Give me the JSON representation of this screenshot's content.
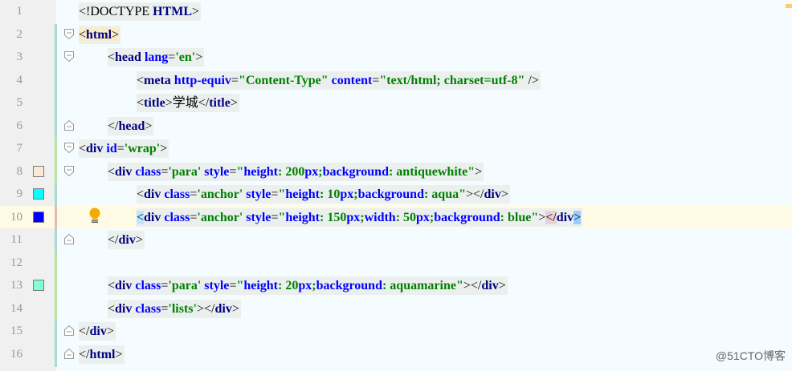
{
  "gutter": {
    "line_numbers": [
      "1",
      "2",
      "3",
      "4",
      "5",
      "6",
      "7",
      "8",
      "9",
      "10",
      "11",
      "12",
      "13",
      "14",
      "15",
      "16"
    ],
    "color_swatches": {
      "8": "#faebd7",
      "9": "#00ffff",
      "10": "#0000ff",
      "13": "#7fffd4"
    }
  },
  "editor": {
    "current_line": 10,
    "lines": [
      {
        "n": 1,
        "indent": 0,
        "fold": "",
        "tokens": [
          [
            "br",
            "<!DOCTYPE "
          ],
          [
            "tag",
            "HTML"
          ],
          [
            "br",
            ">"
          ]
        ]
      },
      {
        "n": 2,
        "indent": 0,
        "fold": "open",
        "tokens": [
          [
            "br",
            "<"
          ],
          [
            "tag",
            "html"
          ],
          [
            "br",
            ">"
          ]
        ]
      },
      {
        "n": 3,
        "indent": 1,
        "fold": "open",
        "tokens": [
          [
            "br",
            "<"
          ],
          [
            "tag",
            "head "
          ],
          [
            "attr",
            "lang"
          ],
          [
            "br",
            "="
          ],
          [
            "str",
            "'en'"
          ],
          [
            "br",
            ">"
          ]
        ]
      },
      {
        "n": 4,
        "indent": 2,
        "fold": "",
        "tokens": [
          [
            "br",
            "<"
          ],
          [
            "tag",
            "meta "
          ],
          [
            "attr",
            "http-equiv"
          ],
          [
            "br",
            "="
          ],
          [
            "str",
            "\"Content-Type\" "
          ],
          [
            "attr",
            "content"
          ],
          [
            "br",
            "="
          ],
          [
            "str",
            "\"text/html; charset=utf-8\" "
          ],
          [
            "br",
            "/>"
          ]
        ]
      },
      {
        "n": 5,
        "indent": 2,
        "fold": "",
        "tokens": [
          [
            "br",
            "<"
          ],
          [
            "tag",
            "title"
          ],
          [
            "br",
            ">"
          ],
          [
            "txt",
            "学城"
          ],
          [
            "br",
            "</"
          ],
          [
            "tag",
            "title"
          ],
          [
            "br",
            ">"
          ]
        ]
      },
      {
        "n": 6,
        "indent": 1,
        "fold": "close",
        "tokens": [
          [
            "br",
            "</"
          ],
          [
            "tag",
            "head"
          ],
          [
            "br",
            ">"
          ]
        ]
      },
      {
        "n": 7,
        "indent": 0,
        "fold": "open",
        "tokens": [
          [
            "br",
            "<"
          ],
          [
            "tag",
            "div "
          ],
          [
            "attr",
            "id"
          ],
          [
            "br",
            "="
          ],
          [
            "str",
            "'wrap'"
          ],
          [
            "br",
            ">"
          ]
        ]
      },
      {
        "n": 8,
        "indent": 1,
        "fold": "open",
        "tokens": [
          [
            "br",
            "<"
          ],
          [
            "tag",
            "div "
          ],
          [
            "attr",
            "class"
          ],
          [
            "br",
            "="
          ],
          [
            "str",
            "'para' "
          ],
          [
            "attr",
            "style"
          ],
          [
            "br",
            "="
          ],
          [
            "str",
            "\""
          ],
          [
            "attr",
            "height"
          ],
          [
            "str",
            ": 200"
          ],
          [
            "attr",
            "px"
          ],
          [
            "str",
            ";"
          ],
          [
            "attr",
            "background"
          ],
          [
            "str",
            ": antiquewhite\""
          ],
          [
            "br",
            ">"
          ]
        ]
      },
      {
        "n": 9,
        "indent": 2,
        "fold": "",
        "tokens": [
          [
            "br",
            "<"
          ],
          [
            "tag",
            "div "
          ],
          [
            "attr",
            "class"
          ],
          [
            "br",
            "="
          ],
          [
            "str",
            "'anchor' "
          ],
          [
            "attr",
            "style"
          ],
          [
            "br",
            "="
          ],
          [
            "str",
            "\""
          ],
          [
            "attr",
            "height"
          ],
          [
            "str",
            ": 10"
          ],
          [
            "attr",
            "px"
          ],
          [
            "str",
            ";"
          ],
          [
            "attr",
            "background"
          ],
          [
            "str",
            ": aqua\""
          ],
          [
            "br",
            "></"
          ],
          [
            "tag",
            "div"
          ],
          [
            "br",
            ">"
          ]
        ]
      },
      {
        "n": 10,
        "indent": 2,
        "fold": "",
        "tokens": [
          [
            "br",
            "<"
          ],
          [
            "tag",
            "div "
          ],
          [
            "attr",
            "class"
          ],
          [
            "br",
            "="
          ],
          [
            "str",
            "'anchor' "
          ],
          [
            "attr",
            "style"
          ],
          [
            "br",
            "="
          ],
          [
            "str",
            "\""
          ],
          [
            "attr",
            "height"
          ],
          [
            "str",
            ": 150"
          ],
          [
            "attr",
            "px"
          ],
          [
            "str",
            ";"
          ],
          [
            "attr",
            "width"
          ],
          [
            "str",
            ": 50"
          ],
          [
            "attr",
            "px"
          ],
          [
            "str",
            ";"
          ],
          [
            "attr",
            "background"
          ],
          [
            "str",
            ": blue\""
          ],
          [
            "br",
            ">"
          ],
          [
            "br",
            "</"
          ],
          [
            "tag",
            "div"
          ],
          [
            "br",
            ">"
          ]
        ]
      },
      {
        "n": 11,
        "indent": 1,
        "fold": "close",
        "tokens": [
          [
            "br",
            "</"
          ],
          [
            "tag",
            "div"
          ],
          [
            "br",
            ">"
          ]
        ]
      },
      {
        "n": 12,
        "indent": 0,
        "fold": "",
        "tokens": []
      },
      {
        "n": 13,
        "indent": 1,
        "fold": "",
        "tokens": [
          [
            "br",
            "<"
          ],
          [
            "tag",
            "div "
          ],
          [
            "attr",
            "class"
          ],
          [
            "br",
            "="
          ],
          [
            "str",
            "'para' "
          ],
          [
            "attr",
            "style"
          ],
          [
            "br",
            "="
          ],
          [
            "str",
            "\""
          ],
          [
            "attr",
            "height"
          ],
          [
            "str",
            ": 20"
          ],
          [
            "attr",
            "px"
          ],
          [
            "str",
            ";"
          ],
          [
            "attr",
            "background"
          ],
          [
            "str",
            ": aquamarine\""
          ],
          [
            "br",
            "></"
          ],
          [
            "tag",
            "div"
          ],
          [
            "br",
            ">"
          ]
        ]
      },
      {
        "n": 14,
        "indent": 1,
        "fold": "",
        "tokens": [
          [
            "br",
            "<"
          ],
          [
            "tag",
            "div "
          ],
          [
            "attr",
            "class"
          ],
          [
            "br",
            "="
          ],
          [
            "str",
            "'lists'"
          ],
          [
            "br",
            "></"
          ],
          [
            "tag",
            "div"
          ],
          [
            "br",
            ">"
          ]
        ]
      },
      {
        "n": 15,
        "indent": 0,
        "fold": "close",
        "tokens": [
          [
            "br",
            "</"
          ],
          [
            "tag",
            "div"
          ],
          [
            "br",
            ">"
          ]
        ]
      },
      {
        "n": 16,
        "indent": 0,
        "fold": "close",
        "tokens": [
          [
            "br",
            "</"
          ],
          [
            "tag",
            "html"
          ],
          [
            "br",
            ">"
          ]
        ]
      }
    ]
  },
  "watermark": {
    "text": "@51CTO博客"
  },
  "colors": {
    "current_line_bg": "#fffae3",
    "tag": "#000080",
    "attr": "#0000ff",
    "string": "#008000",
    "gutter_bg": "#f0f0f0",
    "editor_bg": "#f5fcff"
  }
}
